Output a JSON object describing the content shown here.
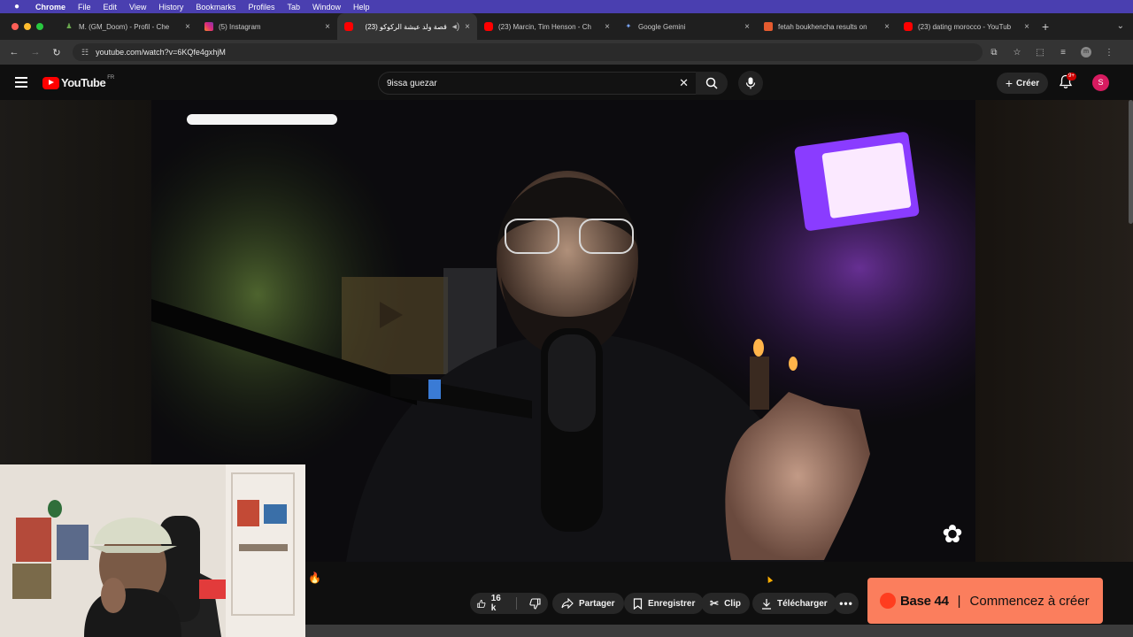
{
  "mac_menu": {
    "app": "Chrome",
    "items": [
      "File",
      "Edit",
      "View",
      "History",
      "Bookmarks",
      "Profiles",
      "Tab",
      "Window",
      "Help"
    ]
  },
  "tabs": [
    {
      "label": "M. (GM_Doom) - Profil - Che",
      "icon": "chess-icon",
      "color": "#6aa84f"
    },
    {
      "label": "(5) Instagram",
      "icon": "instagram-icon",
      "color": "#e1306c"
    },
    {
      "label": "قصة ولد عيشة الركوكو (23)",
      "icon": "youtube-icon",
      "color": "#ff0000",
      "active": true
    },
    {
      "label": "(23) Marcin, Tim Henson - Ch",
      "icon": "youtube-icon",
      "color": "#ff0000"
    },
    {
      "label": "Google Gemini",
      "icon": "gemini-icon",
      "color": "#5b8cff"
    },
    {
      "label": "fetah boukhencha results on",
      "icon": "chess-results-icon",
      "color": "#e55b2f"
    },
    {
      "label": "(23) dating morocco - YouTub",
      "icon": "youtube-icon",
      "color": "#ff0000"
    }
  ],
  "address": {
    "url": "youtube.com/watch?v=6KQfe4gxhjM"
  },
  "youtube": {
    "logo_text": "YouTube",
    "country_code": "FR",
    "search_value": "9issa guezar",
    "create_label": "Créer",
    "notification_badge": "9+",
    "avatar_letter": "S"
  },
  "actions": {
    "like_count": "16 k",
    "share_label": "Partager",
    "save_label": "Enregistrer",
    "clip_label": "Clip",
    "download_label": "Télécharger"
  },
  "ad": {
    "brand": "Base 44",
    "separator": "|",
    "cta": "Commencez à créer"
  },
  "colors": {
    "youtube_red": "#ff0000",
    "menubar": "#4a3fb0",
    "ad_bg": "#fb7e5d"
  }
}
